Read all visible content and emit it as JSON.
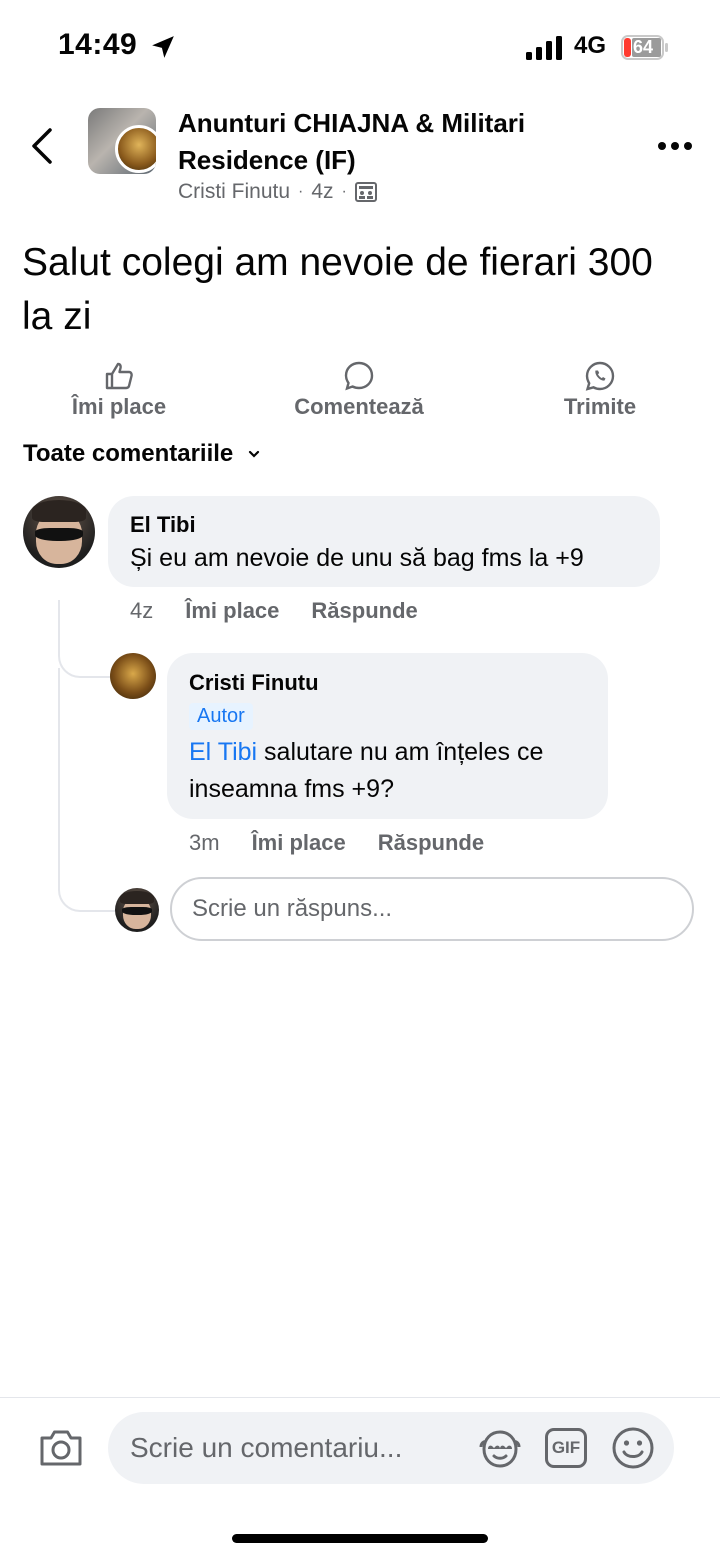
{
  "status": {
    "time": "14:49",
    "network": "4G",
    "battery": "64",
    "icons": [
      "location-arrow-icon",
      "signal-icon",
      "battery-icon"
    ]
  },
  "header": {
    "group_name": "Anunturi CHIAJNA & Militari Residence (IF)",
    "author": "Cristi Finutu",
    "age": "4z",
    "separator": "·",
    "icons": [
      "back-icon",
      "group-privacy-icon",
      "more-icon"
    ]
  },
  "post": {
    "text": "Salut colegi am nevoie de fierari 300 la zi"
  },
  "actions": {
    "like": "Îmi place",
    "comment": "Comentează",
    "share": "Trimite"
  },
  "comments_filter": {
    "label": "Toate comentariile"
  },
  "comments": [
    {
      "name": "El Tibi",
      "text": "Și eu am nevoie de unu să bag fms la +9",
      "time": "4z",
      "like": "Îmi place",
      "reply": "Răspunde",
      "replies": [
        {
          "name": "Cristi Finutu",
          "badge": "Autor",
          "mention": "El Tibi",
          "text": " salutare nu am înțeles ce inseamna fms +9?",
          "time": "3m",
          "like": "Îmi place",
          "reply": "Răspunde"
        }
      ]
    }
  ],
  "reply_input": {
    "placeholder": "Scrie un răspuns..."
  },
  "composer": {
    "placeholder": "Scrie un comentariu...",
    "gif": "GIF",
    "icons": [
      "camera-icon",
      "avatar-sticker-icon",
      "gif-icon",
      "emoji-icon"
    ]
  },
  "colors": {
    "link": "#1877f2",
    "secondary_text": "#65676b",
    "bubble": "#f0f2f5"
  }
}
